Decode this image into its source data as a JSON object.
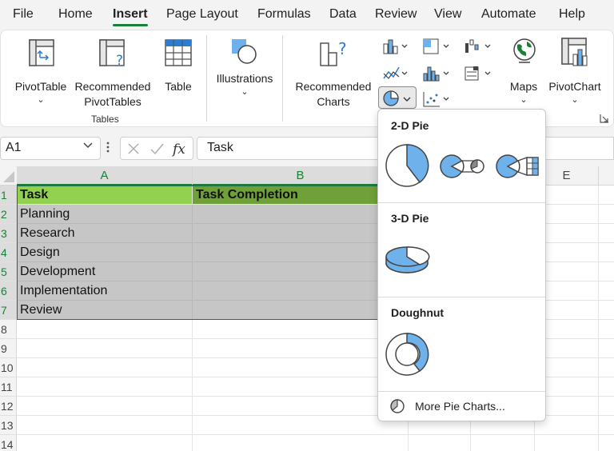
{
  "menu": {
    "tabs": [
      "File",
      "Home",
      "Insert",
      "Page Layout",
      "Formulas",
      "Data",
      "Review",
      "View",
      "Automate",
      "Help"
    ],
    "active": "Insert"
  },
  "ribbon": {
    "pivot_table": "PivotTable",
    "recommended_pivot_line1": "Recommended",
    "recommended_pivot_line2": "PivotTables",
    "table": "Table",
    "illustrations": "Illustrations",
    "recommended_charts_line1": "Recommended",
    "recommended_charts_line2": "Charts",
    "maps": "Maps",
    "pivot_chart": "PivotChart",
    "tables_group": "Tables",
    "chevron": "⌄"
  },
  "formula_bar": {
    "name_box": "A1",
    "formula": "Task"
  },
  "sheet": {
    "columns": [
      "A",
      "B",
      "E"
    ],
    "rows": [
      "1",
      "2",
      "3",
      "4",
      "5",
      "6",
      "7",
      "8",
      "9",
      "10",
      "11",
      "12",
      "13",
      "14"
    ],
    "header_a": "Task",
    "header_b": "Task Completion",
    "tasks": [
      "Planning",
      "Research",
      "Design",
      "Development",
      "Implementation",
      "Review"
    ]
  },
  "pie_dropdown": {
    "section_2d": "2-D Pie",
    "section_3d": "3-D Pie",
    "section_doughnut": "Doughnut",
    "more": "More Pie Charts..."
  },
  "colors": {
    "accent_green": "#1a7f37",
    "header_a_fill": "#92d050",
    "header_b_fill": "#70a03a",
    "selection_fill": "#c6c6c6",
    "chart_blue": "#6fb1ea"
  }
}
